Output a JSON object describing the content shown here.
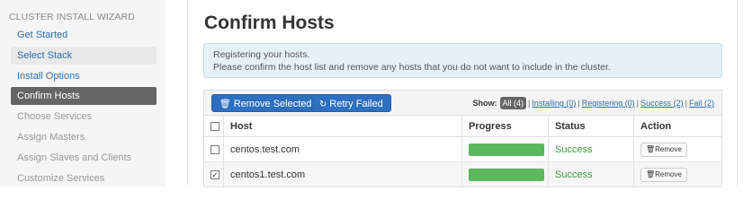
{
  "sidebar": {
    "title": "CLUSTER INSTALL WIZARD",
    "steps": [
      {
        "label": "Get Started",
        "state": "done"
      },
      {
        "label": "Select Stack",
        "state": "done"
      },
      {
        "label": "Install Options",
        "state": "done"
      },
      {
        "label": "Confirm Hosts",
        "state": "current"
      },
      {
        "label": "Choose Services",
        "state": "future"
      },
      {
        "label": "Assign Masters",
        "state": "future"
      },
      {
        "label": "Assign Slaves and Clients",
        "state": "future"
      },
      {
        "label": "Customize Services",
        "state": "future"
      }
    ]
  },
  "main": {
    "title": "Confirm Hosts",
    "info": {
      "line1": "Registering your hosts.",
      "line2": "Please confirm the host list and remove any hosts that you do not want to include in the cluster."
    },
    "toolbar": {
      "remove_selected": "Remove Selected",
      "retry_failed": "Retry Failed",
      "show_label": "Show:",
      "filter_all": "All (4)",
      "filter_installing": "Installing (0)",
      "filter_registering": "Registering (0)",
      "filter_success": "Success (2)",
      "filter_fail": "Fail (2)"
    },
    "columns": {
      "host": "Host",
      "progress": "Progress",
      "status": "Status",
      "action": "Action"
    },
    "rows": [
      {
        "host": "centos.test.com",
        "progress": 1.0,
        "status": "Success",
        "action": "Remove",
        "checked": false
      },
      {
        "host": "centos1.test.com",
        "progress": 1.0,
        "status": "Success",
        "action": "Remove",
        "checked": true
      }
    ]
  },
  "colors": {
    "primary": "#2f6fc0",
    "success": "#5cb85c",
    "info_bg": "#e6f0f7",
    "sidebar_current": "#666666"
  }
}
